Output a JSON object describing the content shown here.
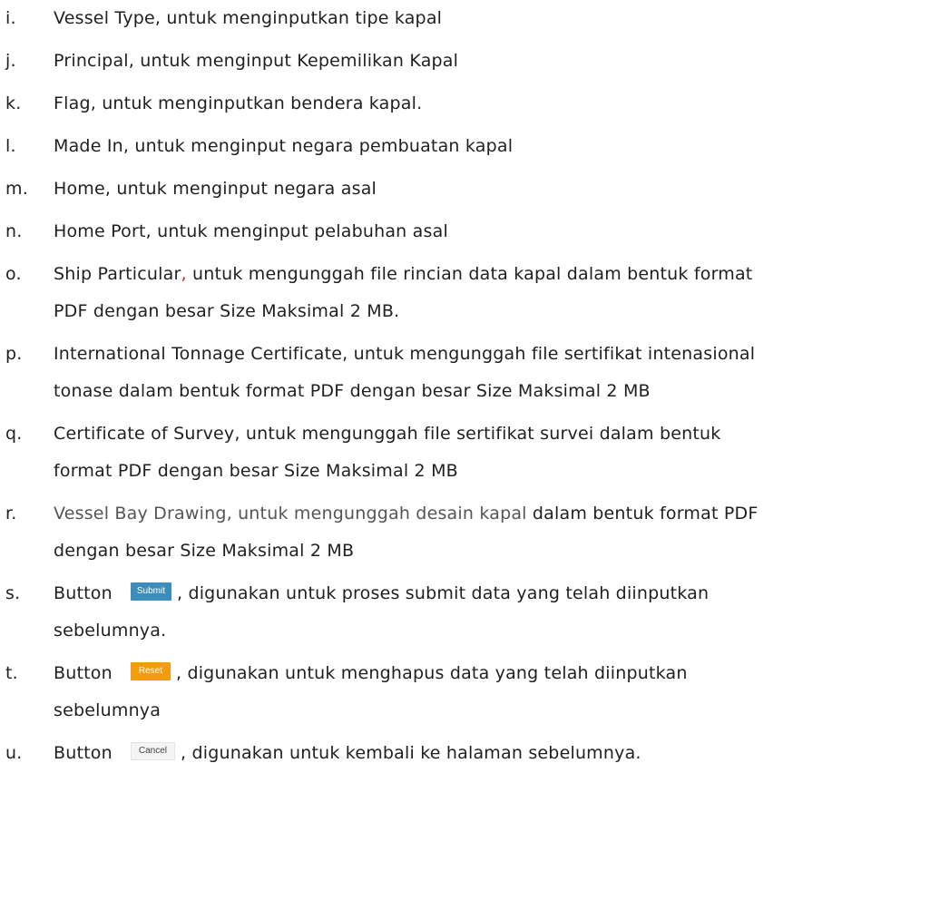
{
  "items": [
    {
      "marker": "i.",
      "text": "Vessel Type, untuk menginputkan tipe kapal"
    },
    {
      "marker": "j.",
      "text": "Principal, untuk menginput Kepemilikan Kapal"
    },
    {
      "marker": "k.",
      "text": "Flag, untuk menginputkan bendera kapal."
    },
    {
      "marker": "l.",
      "text": "Made In, untuk menginput negara pembuatan kapal"
    },
    {
      "marker": "m.",
      "text": "Home, untuk menginput negara asal"
    },
    {
      "marker": "n.",
      "text": "Home Port, untuk menginput pelabuhan asal"
    },
    {
      "marker": "o.",
      "name": "Ship Particular",
      "comma": ",",
      "line1_rest": " untuk mengunggah file rincian data kapal dalam bentuk format",
      "line2": "PDF dengan besar Size Maksimal 2 MB."
    },
    {
      "marker": "p.",
      "line1": "International Tonnage Certificate, untuk mengunggah file sertifikat intenasional",
      "line2": "tonase dalam bentuk format PDF dengan besar Size Maksimal 2 MB"
    },
    {
      "marker": "q.",
      "line1": "Certificate of Survey, untuk mengunggah file sertifikat survei dalam bentuk",
      "line2": "format PDF dengan besar Size Maksimal 2 MB"
    },
    {
      "marker": "r.",
      "grey_part": "Vessel Bay Drawing, untuk mengunggah desain kapal",
      "line1_rest": " dalam bentuk format PDF",
      "line2": "dengan besar Size Maksimal 2 MB"
    },
    {
      "marker": "s.",
      "prefix": "Button",
      "button_label": "Submit",
      "line1_rest": ", digunakan untuk proses submit data yang  telah  diinputkan",
      "line2": "sebelumnya."
    },
    {
      "marker": "t.",
      "prefix": "Button",
      "button_label": "Reset",
      "line1_rest": ", digunakan untuk menghapus data yang telah diinputkan",
      "line2": "sebelumnya"
    },
    {
      "marker": "u.",
      "prefix": "Button",
      "button_label": "Cancel",
      "line1_rest": ", digunakan untuk kembali ke halaman sebelumnya."
    }
  ],
  "colors": {
    "text": "#1f1f1f",
    "comma_red": "#d42020",
    "grey_text": "#555555",
    "submit_button": "#3c8dbc",
    "reset_button": "#f39c12",
    "cancel_button": "#f4f4f4"
  }
}
